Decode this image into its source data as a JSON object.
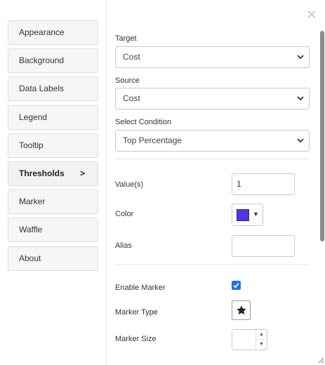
{
  "sidebar": {
    "items": [
      {
        "label": "Appearance"
      },
      {
        "label": "Background"
      },
      {
        "label": "Data Labels"
      },
      {
        "label": "Legend"
      },
      {
        "label": "Tooltip"
      },
      {
        "label": "Thresholds",
        "arrow": ">"
      },
      {
        "label": "Marker"
      },
      {
        "label": "Waffle"
      },
      {
        "label": "About"
      }
    ],
    "active": "Thresholds"
  },
  "form": {
    "target": {
      "label": "Target",
      "value": "Cost"
    },
    "source": {
      "label": "Source",
      "value": "Cost"
    },
    "condition": {
      "label": "Select Condition",
      "value": "Top Percentage"
    },
    "values": {
      "label": "Value(s)",
      "value": "1"
    },
    "color": {
      "label": "Color",
      "value": "#5533ee"
    },
    "alias": {
      "label": "Alias",
      "value": ""
    },
    "enable_marker": {
      "label": "Enable Marker",
      "checked": true
    },
    "marker_type": {
      "label": "Marker Type",
      "icon": "star-icon"
    },
    "marker_size": {
      "label": "Marker Size",
      "value": ""
    }
  },
  "colors": {
    "accent": "#1a73e8",
    "swatch": "#5533ee"
  }
}
